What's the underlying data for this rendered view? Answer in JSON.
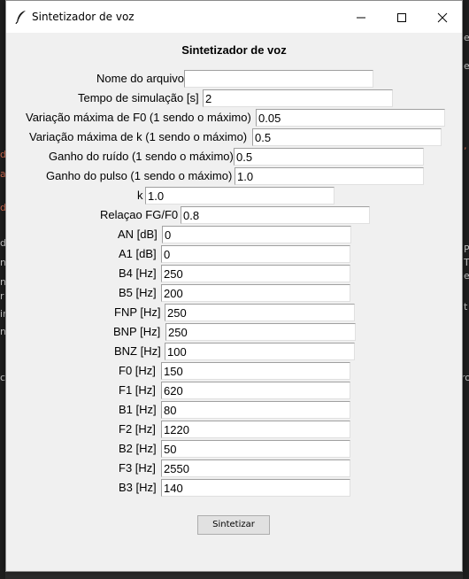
{
  "window": {
    "title": "Sintetizador de voz",
    "controls": {
      "minimize": "minimize",
      "maximize": "maximize",
      "close": "close"
    }
  },
  "form": {
    "heading": "Sintetizador de voz",
    "fields": [
      {
        "label": "Nome do arquivo",
        "value": ""
      },
      {
        "label": "Tempo de simulação [s]",
        "value": "2"
      },
      {
        "label": "Variação máxima de F0 (1 sendo o máximo)",
        "value": "0.05"
      },
      {
        "label": "Variação máxima de k (1 sendo o máximo)",
        "value": "0.5"
      },
      {
        "label": "Ganho do ruído (1 sendo o máximo)",
        "value": "0.5"
      },
      {
        "label": "Ganho do pulso (1 sendo o máximo)",
        "value": "1.0"
      },
      {
        "label": "k",
        "value": "1.0"
      },
      {
        "label": "Relaçao FG/F0",
        "value": "0.8"
      },
      {
        "label": "AN [dB]",
        "value": "0"
      },
      {
        "label": "A1 [dB]",
        "value": "0"
      },
      {
        "label": "B4 [Hz]",
        "value": "250"
      },
      {
        "label": "B5 [Hz]",
        "value": "200"
      },
      {
        "label": "FNP [Hz]",
        "value": "250"
      },
      {
        "label": "BNP [Hz]",
        "value": "250"
      },
      {
        "label": "BNZ [Hz]",
        "value": "100"
      },
      {
        "label": "F0 [Hz]",
        "value": "150"
      },
      {
        "label": "F1 [Hz]",
        "value": "620"
      },
      {
        "label": "B1 [Hz]",
        "value": "80"
      },
      {
        "label": "F2 [Hz]",
        "value": "1220"
      },
      {
        "label": "B2 [Hz]",
        "value": "50"
      },
      {
        "label": "F3 [Hz]",
        "value": "2550"
      },
      {
        "label": "B3 [Hz]",
        "value": "140"
      }
    ],
    "submit_label": "Sintetizar"
  }
}
